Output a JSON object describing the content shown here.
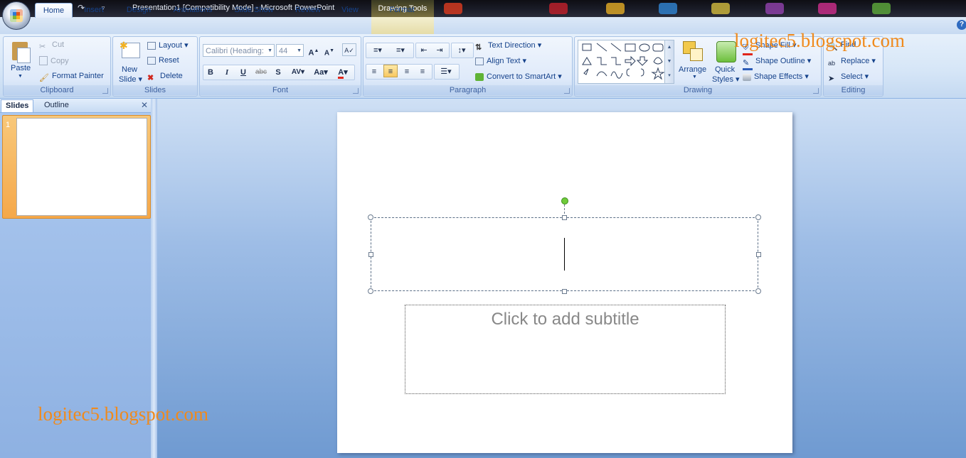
{
  "window": {
    "title": "Presentation1 [Compatibility Mode] - Microsoft PowerPoint",
    "context_tab_group": "Drawing Tools"
  },
  "tabs": [
    "Home",
    "Insert",
    "Design",
    "Animations",
    "Slide Show",
    "Review",
    "View"
  ],
  "context_tab": "Format",
  "ribbon": {
    "clipboard": {
      "label": "Clipboard",
      "paste": "Paste",
      "cut": "Cut",
      "copy": "Copy",
      "format_painter": "Format Painter"
    },
    "slides": {
      "label": "Slides",
      "new_slide": "New Slide",
      "layout": "Layout",
      "reset": "Reset",
      "delete": "Delete"
    },
    "font": {
      "label": "Font",
      "font_name": "Calibri (Heading:",
      "font_size": "44"
    },
    "paragraph": {
      "label": "Paragraph",
      "text_direction": "Text Direction",
      "align_text": "Align Text",
      "convert_smartart": "Convert to SmartArt"
    },
    "drawing": {
      "label": "Drawing",
      "arrange": "Arrange",
      "quick_styles": "Quick Styles",
      "shape_fill": "Shape Fill",
      "shape_outline": "Shape Outline",
      "shape_effects": "Shape Effects"
    },
    "editing": {
      "label": "Editing",
      "find": "Find",
      "replace": "Replace",
      "select": "Select"
    }
  },
  "left_panel": {
    "tab_slides": "Slides",
    "tab_outline": "Outline",
    "slide_number": "1"
  },
  "slide": {
    "subtitle_placeholder": "Click to add subtitle"
  },
  "watermark": "logitec5.blogspot.com",
  "colors": {
    "watermark": "#f08a1c",
    "selected_thumb": "#f5a84a",
    "rotate_handle": "#6fcb3a"
  }
}
